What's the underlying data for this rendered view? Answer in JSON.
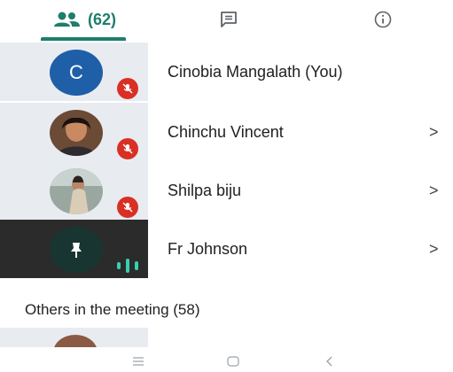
{
  "tabs": {
    "people_count": "(62)",
    "active": "people"
  },
  "participants": [
    {
      "name": "Cinobia Mangalath (You)",
      "avatar_type": "initial",
      "initial": "C",
      "mic": "muted",
      "has_chevron": false
    },
    {
      "name": "Chinchu Vincent",
      "avatar_type": "photo",
      "mic": "muted",
      "has_chevron": true
    },
    {
      "name": "Shilpa biju",
      "avatar_type": "photo",
      "mic": "muted",
      "has_chevron": true
    },
    {
      "name": "Fr Johnson",
      "avatar_type": "pinned",
      "mic": "speaking",
      "has_chevron": true
    }
  ],
  "chevron_glyph": ">",
  "others_section": {
    "title": "Others in the meeting (58)"
  },
  "colors": {
    "accent": "#1e7e6c",
    "muted_badge": "#d93025",
    "initial_avatar": "#1f5fa8",
    "tile_bg": "#e8ecf1",
    "speaking_bars": "#37d0b0"
  },
  "icons": {
    "people_tab": "people-icon",
    "chat_tab": "chat-icon",
    "info_tab": "info-icon",
    "mic_off": "mic-off-icon",
    "pin": "pin-icon",
    "nav_recent": "menu-icon",
    "nav_home": "home-icon",
    "nav_back": "back-icon"
  }
}
